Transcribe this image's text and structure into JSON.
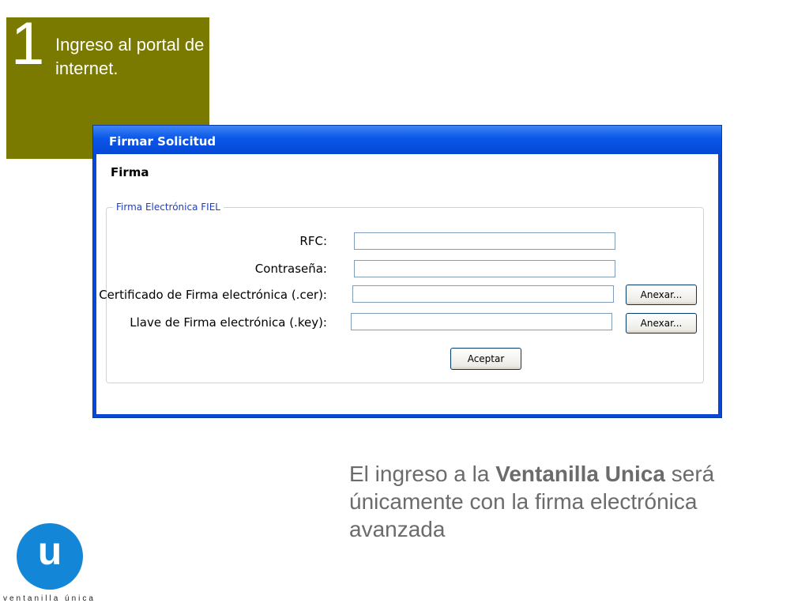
{
  "step": {
    "number": "1",
    "text": "Ingreso al portal de internet."
  },
  "dialog": {
    "title": "Firmar Solicitud",
    "section_title": "Firma",
    "fieldset_legend": "Firma Electrónica FIEL",
    "fields": [
      {
        "label": "RFC:",
        "value": ""
      },
      {
        "label": "Contraseña:",
        "value": ""
      },
      {
        "label": "Certificado de Firma electrónica (.cer):",
        "value": ""
      },
      {
        "label": "Llave de Firma electrónica (.key):",
        "value": ""
      }
    ],
    "attach_label": "Anexar...",
    "accept_label": "Aceptar"
  },
  "caption": {
    "prefix": "El ingreso a la ",
    "bold": "Ventanilla Unica",
    "suffix": " será únicamente con la firma electrónica avanzada"
  },
  "logo": {
    "letter": "u",
    "text": "ventanilla única"
  },
  "colors": {
    "step_box": "#7a7a00",
    "titlebar": "#0a56e8",
    "logo": "#1486d8",
    "caption": "#6b6b6b"
  }
}
